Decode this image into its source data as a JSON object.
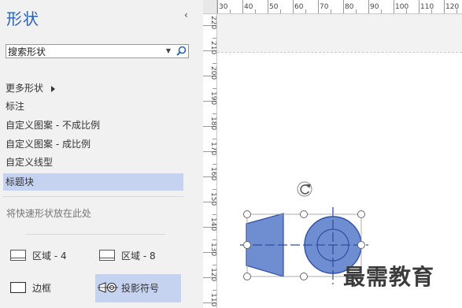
{
  "pane": {
    "title": "形状",
    "collapse_glyph": "‹",
    "search_value": "搜索形状",
    "search_placeholder": "搜索形状"
  },
  "nav": [
    {
      "label": "更多形状",
      "has_arrow": true
    },
    {
      "label": "标注"
    },
    {
      "label": "自定义图案 - 不成比例"
    },
    {
      "label": "自定义图案 - 成比例"
    },
    {
      "label": "自定义线型"
    },
    {
      "label": "标题块",
      "selected": true
    }
  ],
  "hint": "将快速形状放在此处",
  "stencils": [
    {
      "label": "区域 - 4",
      "icon": "region-4-icon"
    },
    {
      "label": "区域 - 8",
      "icon": "region-8-icon"
    },
    {
      "label": "边框",
      "icon": "border-icon"
    },
    {
      "label": "投影符号",
      "icon": "projection-symbol-icon",
      "selected": true
    }
  ],
  "ruler": {
    "horizontal": [
      "30",
      "40",
      "50",
      "60",
      "70",
      "80",
      "90",
      "100",
      "110",
      "120"
    ],
    "vertical": [
      "220",
      "210",
      "200",
      "190",
      "180",
      "170",
      "160",
      "150",
      "140",
      "130",
      "120",
      "110"
    ]
  },
  "watermark": "最需教育",
  "colors": {
    "accent": "#2d61b3",
    "selected": "#c5d3f0",
    "shape_fill": "#6f8ed2",
    "shape_stroke": "#2f4fa3"
  }
}
